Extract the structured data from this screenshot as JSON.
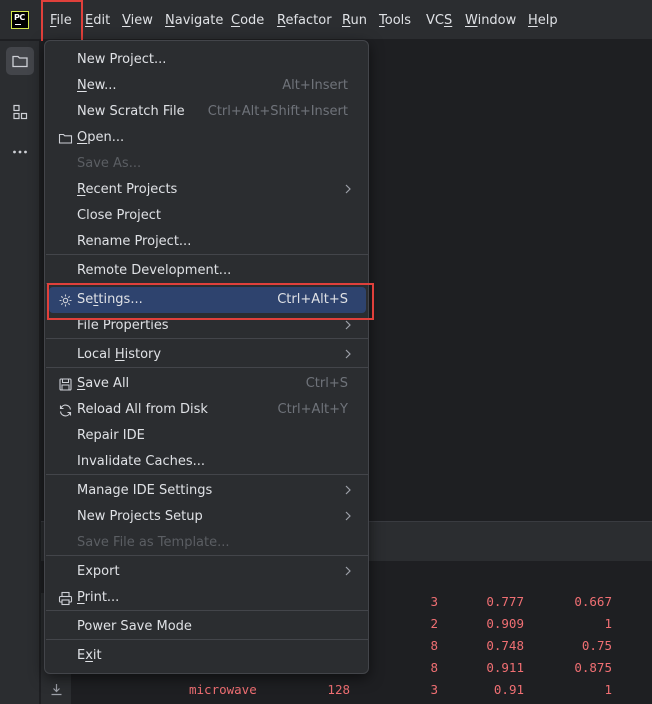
{
  "app": {
    "logo_text": "PC"
  },
  "menubar": {
    "items": [
      {
        "label": "File",
        "mnemonic_index": 0
      },
      {
        "label": "Edit",
        "mnemonic_index": 0
      },
      {
        "label": "View",
        "mnemonic_index": 0
      },
      {
        "label": "Navigate",
        "mnemonic_index": 0
      },
      {
        "label": "Code",
        "mnemonic_index": 0
      },
      {
        "label": "Refactor",
        "mnemonic_index": 0
      },
      {
        "label": "Run",
        "mnemonic_index": 0
      },
      {
        "label": "Tools",
        "mnemonic_index": 0
      },
      {
        "label": "VCS",
        "mnemonic_index": 2
      },
      {
        "label": "Window",
        "mnemonic_index": 0
      },
      {
        "label": "Help",
        "mnemonic_index": 0
      }
    ]
  },
  "leftstrip": {
    "icons": [
      "project-folder-icon",
      "structure-icon",
      "more-icon"
    ]
  },
  "file_menu": {
    "items": [
      {
        "label": "New Project...",
        "shortcut": "",
        "icon": "",
        "submenu": false,
        "disabled": false
      },
      {
        "label": "New...",
        "shortcut": "Alt+Insert",
        "icon": "",
        "submenu": false,
        "disabled": false
      },
      {
        "label": "New Scratch File",
        "shortcut": "Ctrl+Alt+Shift+Insert",
        "icon": "",
        "submenu": false,
        "disabled": false
      },
      {
        "label": "Open...",
        "shortcut": "",
        "icon": "folder-icon",
        "submenu": false,
        "disabled": false
      },
      {
        "label": "Save As...",
        "shortcut": "",
        "icon": "",
        "submenu": false,
        "disabled": true
      },
      {
        "label": "Recent Projects",
        "shortcut": "",
        "icon": "",
        "submenu": true,
        "disabled": false
      },
      {
        "label": "Close Project",
        "shortcut": "",
        "icon": "",
        "submenu": false,
        "disabled": false
      },
      {
        "label": "Rename Project...",
        "shortcut": "",
        "icon": "",
        "submenu": false,
        "disabled": false
      },
      {
        "label": "Remote Development...",
        "shortcut": "",
        "icon": "",
        "submenu": false,
        "disabled": false
      },
      {
        "label": "Settings...",
        "shortcut": "Ctrl+Alt+S",
        "icon": "gear-icon",
        "submenu": false,
        "disabled": false,
        "selected": true
      },
      {
        "label": "File Properties",
        "shortcut": "",
        "icon": "",
        "submenu": true,
        "disabled": false
      },
      {
        "label": "Local History",
        "shortcut": "",
        "icon": "",
        "submenu": true,
        "disabled": false
      },
      {
        "label": "Save All",
        "shortcut": "Ctrl+S",
        "icon": "save-icon",
        "submenu": false,
        "disabled": false
      },
      {
        "label": "Reload All from Disk",
        "shortcut": "Ctrl+Alt+Y",
        "icon": "reload-icon",
        "submenu": false,
        "disabled": false
      },
      {
        "label": "Repair IDE",
        "shortcut": "",
        "icon": "",
        "submenu": false,
        "disabled": false
      },
      {
        "label": "Invalidate Caches...",
        "shortcut": "",
        "icon": "",
        "submenu": false,
        "disabled": false
      },
      {
        "label": "Manage IDE Settings",
        "shortcut": "",
        "icon": "",
        "submenu": true,
        "disabled": false
      },
      {
        "label": "New Projects Setup",
        "shortcut": "",
        "icon": "",
        "submenu": true,
        "disabled": false
      },
      {
        "label": "Save File as Template...",
        "shortcut": "",
        "icon": "",
        "submenu": false,
        "disabled": true
      },
      {
        "label": "Export",
        "shortcut": "",
        "icon": "",
        "submenu": true,
        "disabled": false
      },
      {
        "label": "Print...",
        "shortcut": "",
        "icon": "print-icon",
        "submenu": false,
        "disabled": false
      },
      {
        "label": "Power Save Mode",
        "shortcut": "",
        "icon": "",
        "submenu": false,
        "disabled": false
      },
      {
        "label": "Exit",
        "shortcut": "",
        "icon": "",
        "submenu": false,
        "disabled": false
      }
    ]
  },
  "data_grid": {
    "rows": [
      {
        "name": "",
        "size": "",
        "a": "3",
        "b": "0.777",
        "c": "0.667"
      },
      {
        "name": "",
        "size": "",
        "a": "2",
        "b": "0.909",
        "c": "1"
      },
      {
        "name": "",
        "size": "",
        "a": "8",
        "b": "0.748",
        "c": "0.75"
      },
      {
        "name": "",
        "size": "",
        "a": "8",
        "b": "0.911",
        "c": "0.875"
      },
      {
        "name": "microwave",
        "size": "128",
        "a": "3",
        "b": "0.91",
        "c": "1"
      }
    ]
  },
  "colors": {
    "accent_selection": "#2e436e",
    "highlight_box": "#e0403b",
    "grid_text": "#f06f73"
  }
}
